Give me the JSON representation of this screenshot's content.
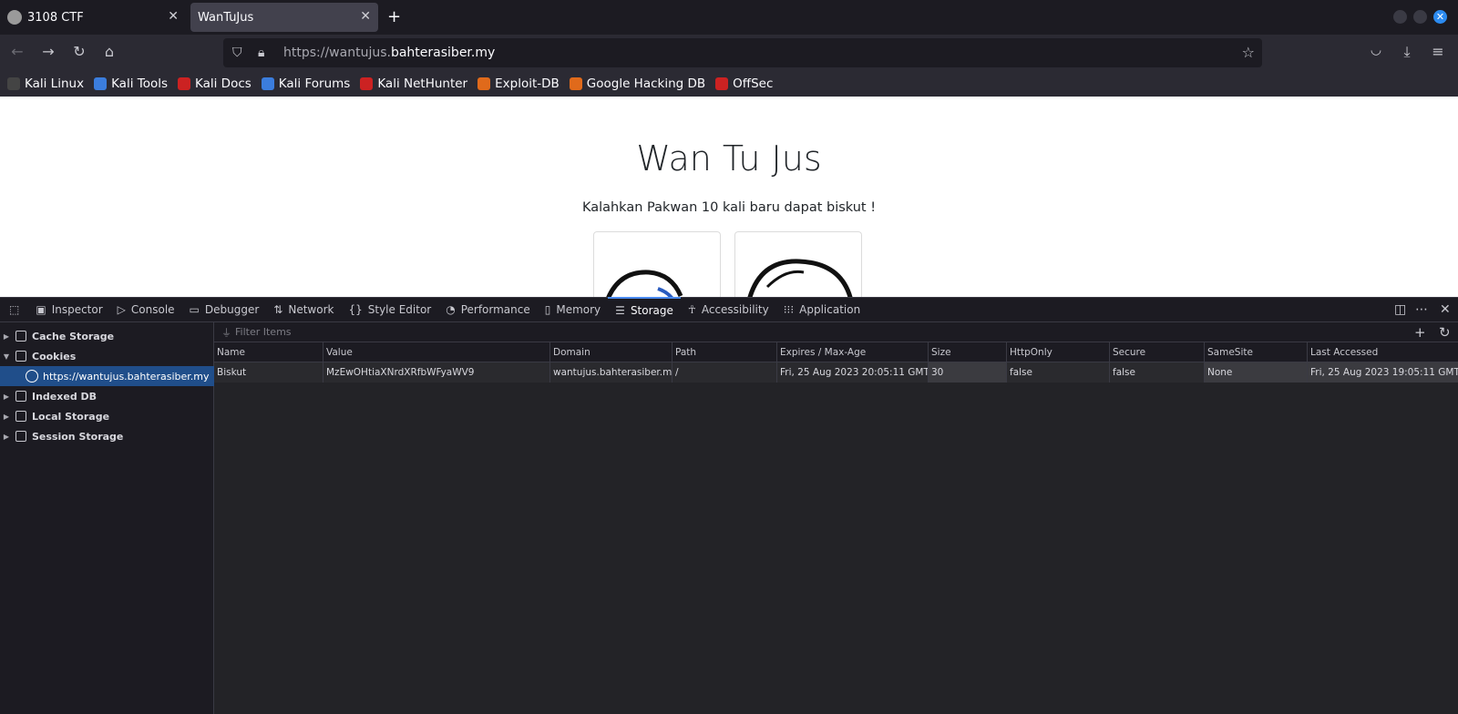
{
  "tabs": [
    {
      "title": "3108 CTF"
    },
    {
      "title": "WanTuJus"
    }
  ],
  "url": {
    "prefix": "https://wantujus.",
    "main": "bahterasiber.my"
  },
  "bookmarks": [
    {
      "label": "Kali Linux",
      "color": "#444444"
    },
    {
      "label": "Kali Tools",
      "color": "#3b7ddd"
    },
    {
      "label": "Kali Docs",
      "color": "#cc2222"
    },
    {
      "label": "Kali Forums",
      "color": "#3b7ddd"
    },
    {
      "label": "Kali NetHunter",
      "color": "#cc2222"
    },
    {
      "label": "Exploit-DB",
      "color": "#e06a1b"
    },
    {
      "label": "Google Hacking DB",
      "color": "#e06a1b"
    },
    {
      "label": "OffSec",
      "color": "#cc2222"
    }
  ],
  "page": {
    "title": "Wan Tu Jus",
    "subtitle": "Kalahkan Pakwan 10 kali baru dapat biskut !"
  },
  "devtools": {
    "tabs": [
      {
        "label": "Inspector",
        "icon": "inspector-icon"
      },
      {
        "label": "Console",
        "icon": "console-icon"
      },
      {
        "label": "Debugger",
        "icon": "debugger-icon"
      },
      {
        "label": "Network",
        "icon": "network-icon"
      },
      {
        "label": "Style Editor",
        "icon": "style-editor-icon"
      },
      {
        "label": "Performance",
        "icon": "performance-icon"
      },
      {
        "label": "Memory",
        "icon": "memory-icon"
      },
      {
        "label": "Storage",
        "icon": "storage-icon",
        "active": true
      },
      {
        "label": "Accessibility",
        "icon": "accessibility-icon"
      },
      {
        "label": "Application",
        "icon": "application-icon"
      }
    ],
    "sidebar": {
      "cache_storage": "Cache Storage",
      "cookies": "Cookies",
      "cookie_host": "https://wantujus.bahterasiber.my",
      "indexed_db": "Indexed DB",
      "local_storage": "Local Storage",
      "session_storage": "Session Storage"
    },
    "filter_placeholder": "Filter Items",
    "columns": [
      "Name",
      "Value",
      "Domain",
      "Path",
      "Expires / Max-Age",
      "Size",
      "HttpOnly",
      "Secure",
      "SameSite",
      "Last Accessed"
    ],
    "rows": [
      [
        "Biskut",
        "MzEwOHtiaXNrdXRfbWFyaWV9",
        "wantujus.bahterasiber.my",
        "/",
        "Fri, 25 Aug 2023 20:05:11 GMT",
        "30",
        "false",
        "false",
        "None",
        "Fri, 25 Aug 2023 19:05:11 GMT"
      ]
    ]
  }
}
